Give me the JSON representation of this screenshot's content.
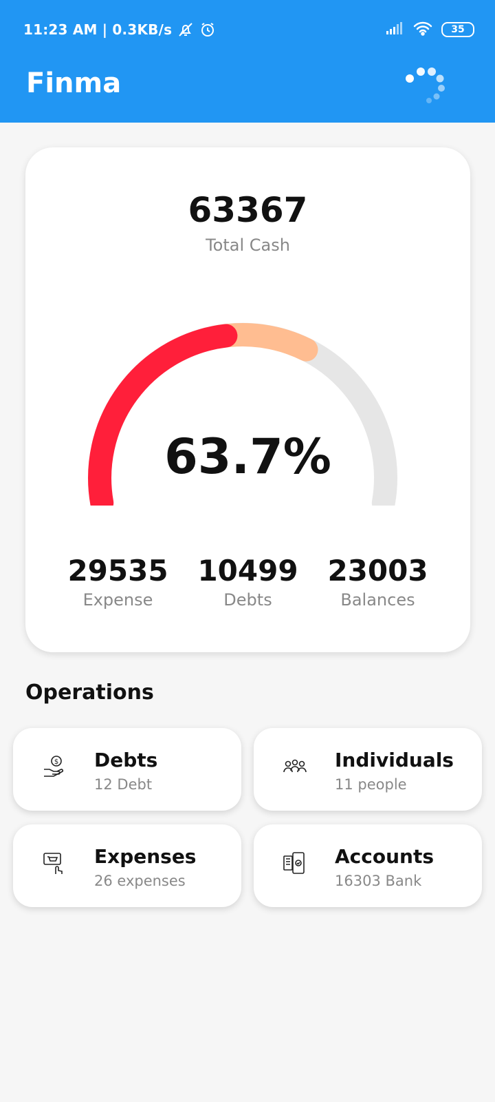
{
  "status_bar": {
    "time_net": "11:23 AM | 0.3KB/s",
    "battery": "35"
  },
  "app": {
    "title": "Finma"
  },
  "summary": {
    "total_cash": "63367",
    "total_cash_label": "Total Cash",
    "percent": "63.7%",
    "gauge": {
      "expense_fraction": 0.466,
      "debts_fraction": 0.166,
      "balances_fraction": 0.363
    },
    "colors": {
      "expense": "#ff1f3a",
      "debts": "#ffbd91",
      "track": "#e6e6e6"
    },
    "stats": [
      {
        "value": "29535",
        "label": "Expense"
      },
      {
        "value": "10499",
        "label": "Debts"
      },
      {
        "value": "23003",
        "label": "Balances"
      }
    ]
  },
  "operations": {
    "title": "Operations",
    "items": [
      {
        "title": "Debts",
        "subtitle": "12 Debt",
        "icon": "money-hand-icon"
      },
      {
        "title": "Individuals",
        "subtitle": "11 people",
        "icon": "people-icon"
      },
      {
        "title": "Expenses",
        "subtitle": "26 expenses",
        "icon": "cart-click-icon"
      },
      {
        "title": "Accounts",
        "subtitle": "16303 Bank",
        "icon": "phone-accounts-icon"
      }
    ]
  },
  "theme": {
    "primary": "#2196f3",
    "background": "#f6f6f6"
  }
}
